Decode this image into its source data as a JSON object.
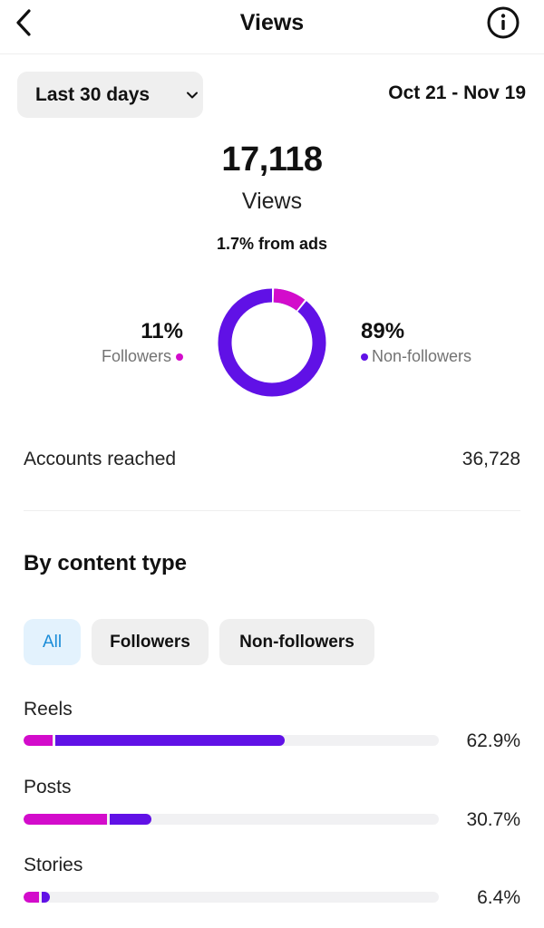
{
  "header": {
    "title": "Views"
  },
  "filter": {
    "range_label": "Last 30 days",
    "date_range": "Oct 21 - Nov 19"
  },
  "summary": {
    "total": "17,118",
    "total_label": "Views",
    "ads_note": "1.7% from ads"
  },
  "audience": {
    "followers_pct": "11%",
    "followers_label": "Followers",
    "followers_share": 0.11,
    "non_followers_pct": "89%",
    "non_followers_label": "Non-followers",
    "non_followers_share": 0.89
  },
  "reach": {
    "label": "Accounts reached",
    "value": "36,728"
  },
  "content_type": {
    "title": "By content type",
    "filters": [
      "All",
      "Followers",
      "Non-followers"
    ],
    "active_filter": "All",
    "rows": [
      {
        "label": "Reels",
        "pct": "62.9%",
        "followers_share": 0.069,
        "non_followers_share": 0.56
      },
      {
        "label": "Posts",
        "pct": "30.7%",
        "followers_share": 0.2,
        "non_followers_share": 0.107
      },
      {
        "label": "Stories",
        "pct": "6.4%",
        "followers_share": 0.037,
        "non_followers_share": 0.027
      }
    ]
  },
  "colors": {
    "followers": "#d30ccb",
    "non_followers": "#6011e6",
    "track": "#f1f1f3",
    "active_chip_text": "#1a8cd8"
  },
  "icons": {
    "back": "chevron-left-icon",
    "info": "info-icon",
    "dropdown": "chevron-down-icon"
  }
}
